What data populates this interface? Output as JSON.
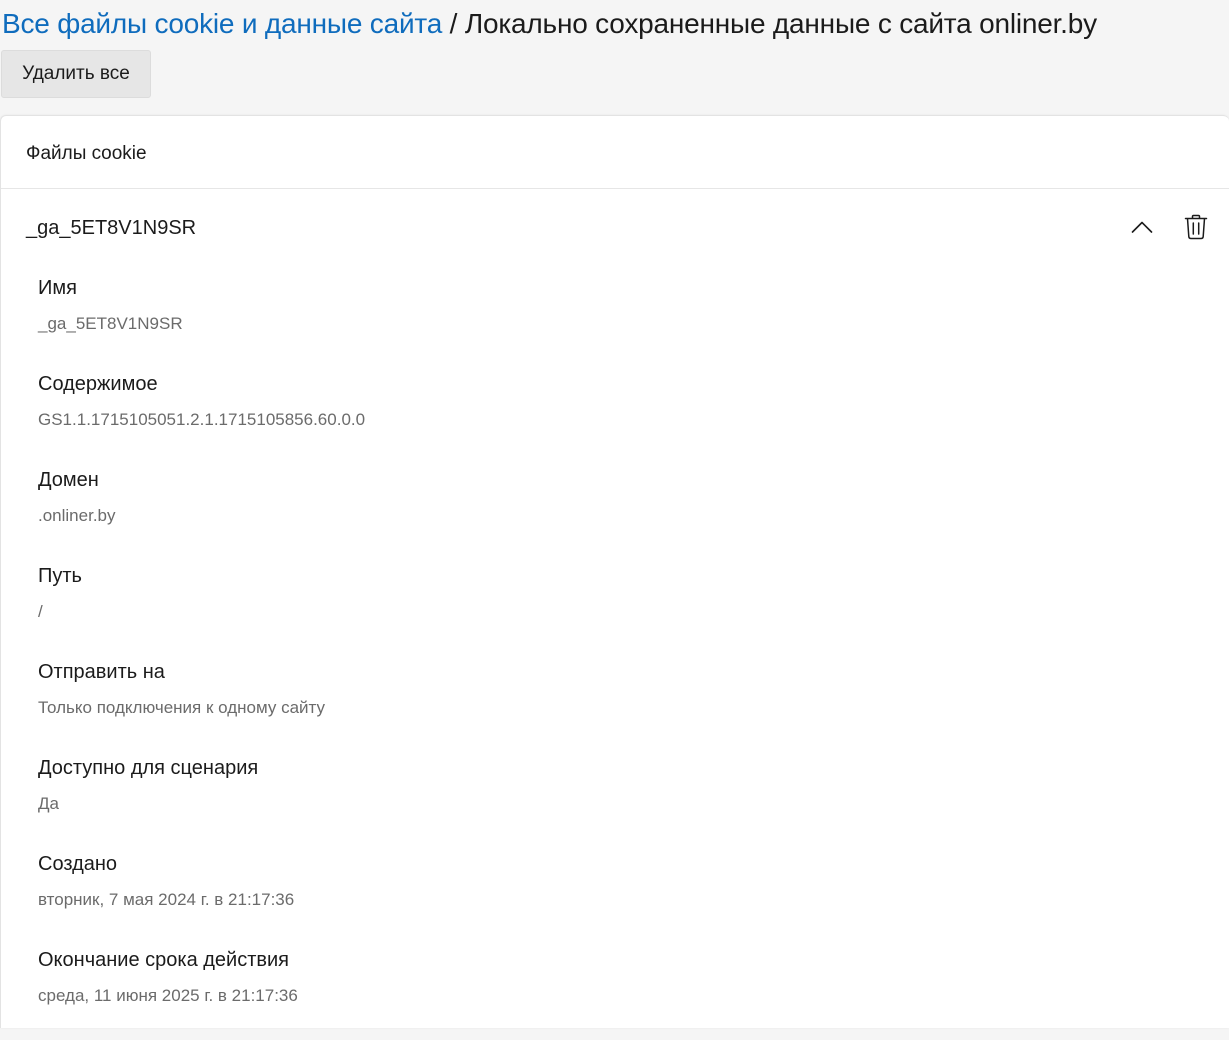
{
  "breadcrumb": {
    "link": "Все файлы cookie и данные сайта",
    "separator": " / ",
    "current": "Локально сохраненные данные с сайта onliner.by"
  },
  "toolbar": {
    "delete_all_label": "Удалить все"
  },
  "card": {
    "title": "Файлы cookie",
    "cookie": {
      "name": "_ga_5ET8V1N9SR",
      "collapse_icon": "chevron-up-icon",
      "delete_icon": "trash-icon",
      "fields": [
        {
          "label": "Имя",
          "value": "_ga_5ET8V1N9SR"
        },
        {
          "label": "Содержимое",
          "value": "GS1.1.1715105051.2.1.1715105856.60.0.0"
        },
        {
          "label": "Домен",
          "value": ".onliner.by"
        },
        {
          "label": "Путь",
          "value": "/"
        },
        {
          "label": "Отправить на",
          "value": "Только подключения к одному сайту"
        },
        {
          "label": "Доступно для сценария",
          "value": "Да"
        },
        {
          "label": "Создано",
          "value": "вторник, 7 мая 2024 г. в 21:17:36"
        },
        {
          "label": "Окончание срока действия",
          "value": "среда, 11 июня 2025 г. в 21:17:36"
        }
      ]
    }
  },
  "colors": {
    "link": "#0f6cbd",
    "secondary_text": "#6b6b6b",
    "page_background": "#f5f5f5"
  }
}
